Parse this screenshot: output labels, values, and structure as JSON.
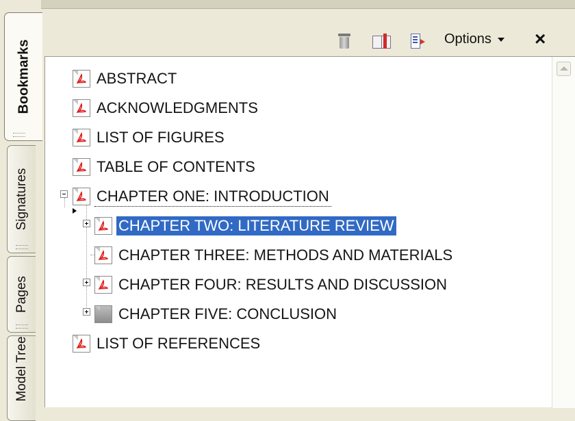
{
  "tabs": [
    {
      "label": "Bookmarks",
      "active": true
    },
    {
      "label": "Signatures",
      "active": false
    },
    {
      "label": "Pages",
      "active": false
    },
    {
      "label": "Model Tree",
      "active": false
    }
  ],
  "toolbar": {
    "delete_icon": "trash-icon",
    "expand_icon": "bookmark-book-icon",
    "new_bookmark_icon": "new-bookmark-icon",
    "options_label": "Options",
    "close_label": "×"
  },
  "bookmarks": [
    {
      "label": "ABSTRACT",
      "level": 0,
      "icon": "pdf-bookmark-icon"
    },
    {
      "label": "ACKNOWLEDGMENTS",
      "level": 0,
      "icon": "pdf-bookmark-icon"
    },
    {
      "label": "LIST OF FIGURES",
      "level": 0,
      "icon": "pdf-bookmark-icon"
    },
    {
      "label": "TABLE OF CONTENTS",
      "level": 0,
      "icon": "pdf-bookmark-icon"
    },
    {
      "label": "CHAPTER ONE: INTRODUCTION",
      "level": 0,
      "icon": "pdf-bookmark-icon",
      "expanded": true
    },
    {
      "label": "CHAPTER TWO: LITERATURE REVIEW",
      "level": 1,
      "icon": "pdf-bookmark-icon",
      "collapsed": true,
      "selected": true
    },
    {
      "label": "CHAPTER THREE: METHODS AND MATERIALS",
      "level": 1,
      "icon": "pdf-bookmark-icon"
    },
    {
      "label": "CHAPTER FOUR: RESULTS AND DISCUSSION",
      "level": 1,
      "icon": "pdf-bookmark-icon",
      "collapsed": true
    },
    {
      "label": "CHAPTER FIVE: CONCLUSION",
      "level": 1,
      "icon": "grey-bookmark-icon",
      "collapsed": true
    },
    {
      "label": "LIST OF REFERENCES",
      "level": 0,
      "icon": "pdf-bookmark-icon"
    }
  ],
  "colors": {
    "selection": "#316ac5",
    "panel_background": "#ffffff",
    "chrome_background": "#ece9d8"
  }
}
